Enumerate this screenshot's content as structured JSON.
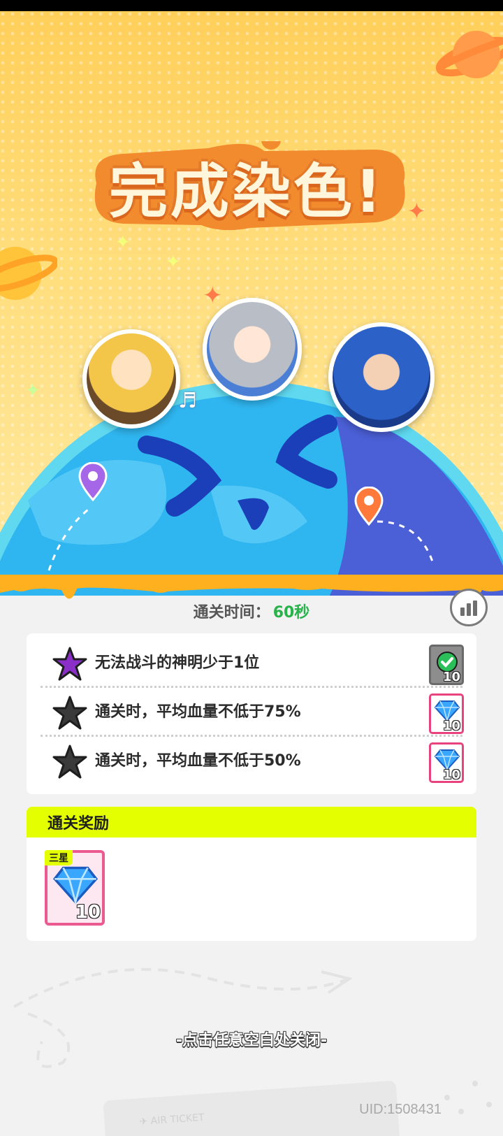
{
  "result": {
    "title": "完成染色!",
    "clear_time_label": "通关时间：",
    "clear_time_value": "60秒"
  },
  "objectives": [
    {
      "text": "无法战斗的神明少于1位",
      "star_color": "#8b2fc9",
      "achieved": true,
      "reward_icon": "check-icon",
      "reward_count": "10"
    },
    {
      "text": "通关时，平均血量不低于75%",
      "star_color": "#3a3a3a",
      "achieved": false,
      "reward_icon": "gem-icon",
      "reward_count": "10"
    },
    {
      "text": "通关时，平均血量不低于50%",
      "star_color": "#3a3a3a",
      "achieved": false,
      "reward_icon": "gem-icon",
      "reward_count": "10"
    }
  ],
  "rewards": {
    "header": "通关奖励",
    "items": [
      {
        "badge": "三星",
        "icon": "gem-icon",
        "count": "10"
      }
    ]
  },
  "footer": {
    "close_hint": "-点击任意空白处关闭-",
    "uid": "UID:1508431"
  },
  "colors": {
    "accent_yellow": "#e3ff00",
    "time_green": "#27b24a",
    "reward_pink": "#ec5a92",
    "title_orange": "#e37a2a"
  }
}
